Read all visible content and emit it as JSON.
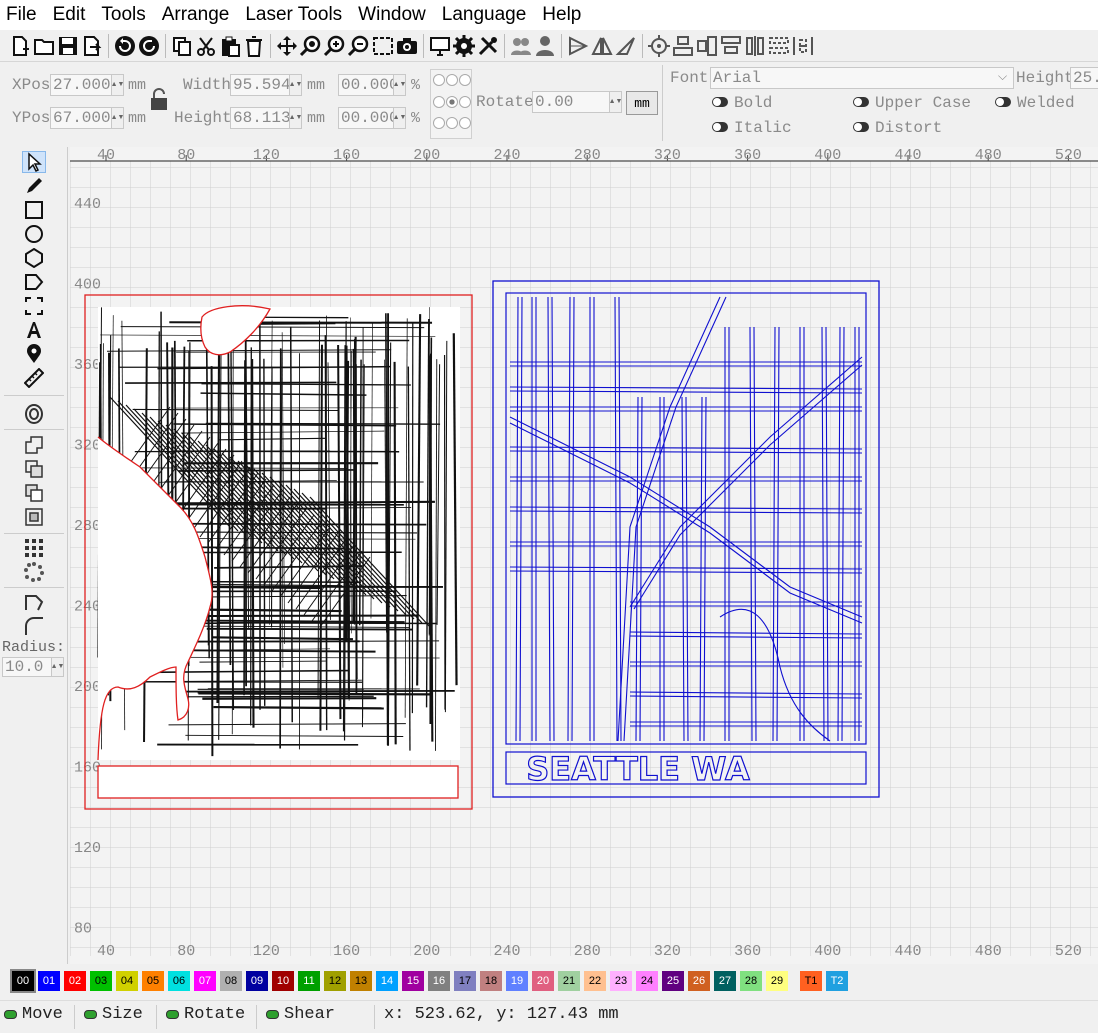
{
  "menu": [
    "File",
    "Edit",
    "Tools",
    "Arrange",
    "Laser Tools",
    "Window",
    "Language",
    "Help"
  ],
  "toolbar_icons": [
    "new-file-icon",
    "open-file-icon",
    "save-icon",
    "save-as-icon",
    "undo-icon",
    "redo-icon",
    "copy-icon",
    "cut-icon",
    "paste-icon",
    "delete-icon",
    "move-icon",
    "zoom-fit-icon",
    "zoom-in-icon",
    "zoom-out-icon",
    "select-box-icon",
    "camera-icon",
    "monitor-icon",
    "settings-icon",
    "tools-icon",
    "group-icon",
    "ungroup-icon",
    "flip-h-icon",
    "flip-v-icon",
    "mirror-icon",
    "center-icon",
    "align-left-icon",
    "align-right-icon",
    "align-top-icon",
    "align-bottom-icon",
    "distribute-h-icon",
    "distribute-v-icon"
  ],
  "props": {
    "xpos_label": "XPos",
    "xpos_value": "27.000",
    "ypos_label": "YPos",
    "ypos_value": "67.000",
    "width_label": "Width",
    "width_value": "95.594",
    "height_label": "Height",
    "height_value": "68.113",
    "unit": "mm",
    "scale_w": "00.000",
    "scale_h": "00.000",
    "pct": "%",
    "rotate_label": "Rotate",
    "rotate_value": "0.00",
    "mm_button": "mm",
    "font_label": "Font",
    "font_value": "Arial",
    "font_height_label": "Height",
    "font_height_value": "25.",
    "bold": "Bold",
    "italic": "Italic",
    "upper": "Upper Case",
    "distort": "Distort",
    "welded": "Welded"
  },
  "left_tools": {
    "radius_label": "Radius:",
    "radius_value": "10.0"
  },
  "ruler": {
    "x_ticks": [
      "40",
      "80",
      "120",
      "160",
      "200",
      "240",
      "280",
      "320",
      "360",
      "400",
      "440",
      "480",
      "520"
    ],
    "y_ticks": [
      "440",
      "400",
      "360",
      "320",
      "280",
      "240",
      "200",
      "160",
      "120",
      "80"
    ]
  },
  "canvas": {
    "map_caption": "SEATTLE WA",
    "red_color": "#e02020",
    "blue_color": "#1010d0"
  },
  "palette": [
    {
      "label": "00",
      "color": "#000000",
      "text": "#ffffff"
    },
    {
      "label": "01",
      "color": "#0000ff",
      "text": "#ffffff"
    },
    {
      "label": "02",
      "color": "#ff0000",
      "text": "#ffffff"
    },
    {
      "label": "03",
      "color": "#00c000",
      "text": "#000000"
    },
    {
      "label": "04",
      "color": "#d0d000",
      "text": "#000000"
    },
    {
      "label": "05",
      "color": "#ff8000",
      "text": "#000000"
    },
    {
      "label": "06",
      "color": "#00e0e0",
      "text": "#000000"
    },
    {
      "label": "07",
      "color": "#ff00ff",
      "text": "#ffffff"
    },
    {
      "label": "08",
      "color": "#b0b0b0",
      "text": "#000000"
    },
    {
      "label": "09",
      "color": "#0000a0",
      "text": "#ffffff"
    },
    {
      "label": "10",
      "color": "#a00000",
      "text": "#ffffff"
    },
    {
      "label": "11",
      "color": "#00a000",
      "text": "#ffffff"
    },
    {
      "label": "12",
      "color": "#a0a000",
      "text": "#000000"
    },
    {
      "label": "13",
      "color": "#c08000",
      "text": "#000000"
    },
    {
      "label": "14",
      "color": "#00a0ff",
      "text": "#ffffff"
    },
    {
      "label": "15",
      "color": "#a000a0",
      "text": "#ffffff"
    },
    {
      "label": "16",
      "color": "#808080",
      "text": "#ffffff"
    },
    {
      "label": "17",
      "color": "#8080c0",
      "text": "#000000"
    },
    {
      "label": "18",
      "color": "#c08080",
      "text": "#000000"
    },
    {
      "label": "19",
      "color": "#6080ff",
      "text": "#ffffff"
    },
    {
      "label": "20",
      "color": "#e06080",
      "text": "#ffffff"
    },
    {
      "label": "21",
      "color": "#a0d0a0",
      "text": "#000000"
    },
    {
      "label": "22",
      "color": "#ffc090",
      "text": "#000000"
    },
    {
      "label": "23",
      "color": "#ffb0ff",
      "text": "#000000"
    },
    {
      "label": "24",
      "color": "#ff80ff",
      "text": "#000000"
    },
    {
      "label": "25",
      "color": "#600080",
      "text": "#ffffff"
    },
    {
      "label": "26",
      "color": "#d06020",
      "text": "#ffffff"
    },
    {
      "label": "27",
      "color": "#006060",
      "text": "#ffffff"
    },
    {
      "label": "28",
      "color": "#80e080",
      "text": "#000000"
    },
    {
      "label": "29",
      "color": "#ffff80",
      "text": "#000000"
    },
    {
      "label": "T1",
      "color": "#ff6020",
      "text": "#000000"
    },
    {
      "label": "T2",
      "color": "#20a0e0",
      "text": "#ffffff"
    }
  ],
  "status": {
    "move": "Move",
    "size": "Size",
    "rotate": "Rotate",
    "shear": "Shear",
    "coords": "x: 523.62, y: 127.43 mm"
  }
}
